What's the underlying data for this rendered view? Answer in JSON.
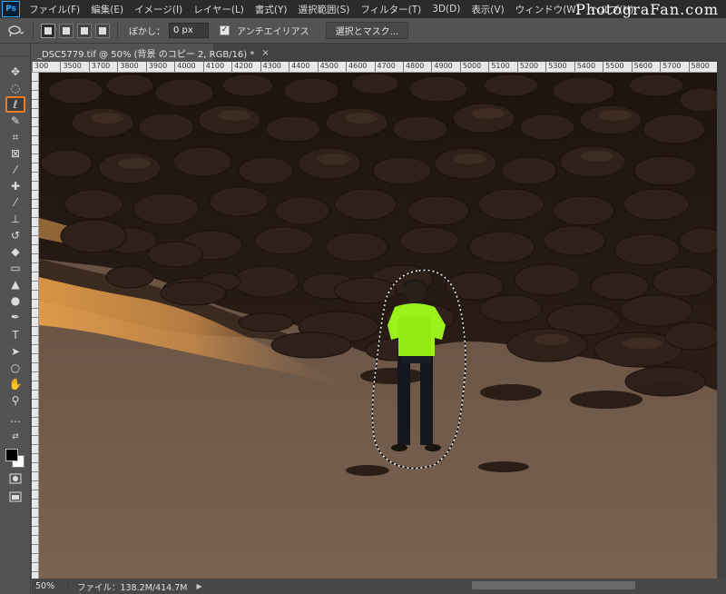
{
  "menu": {
    "logo": "Ps",
    "items": [
      "ファイル(F)",
      "編集(E)",
      "イメージ(I)",
      "レイヤー(L)",
      "書式(Y)",
      "選択範囲(S)",
      "フィルター(T)",
      "3D(D)",
      "表示(V)",
      "ウィンドウ(W)",
      "ヘルプ(H)"
    ],
    "watermark": "PhotograFan.com"
  },
  "options": {
    "feather_label": "ぼかし：",
    "feather_value": "0 px",
    "antialias_label": "アンチエイリアス",
    "antialias_checked": true,
    "select_mask_label": "選択とマスク..."
  },
  "document": {
    "tab_title": "_DSC5779.tif @ 50% (背景 のコピー 2, RGB/16) *",
    "close_glyph": "×"
  },
  "ruler": {
    "top_ticks": [
      "300",
      "3500",
      "3700",
      "3800",
      "3900",
      "4000",
      "4100",
      "4200",
      "4300",
      "4400",
      "4500",
      "4600",
      "4700",
      "4800",
      "4900",
      "5000",
      "5100",
      "5200",
      "5300",
      "5400",
      "5500",
      "5600",
      "5700",
      "5800"
    ]
  },
  "status": {
    "zoom": "50%",
    "file_info": "ファイル：138.2M/414.7M",
    "arrow": "▶"
  },
  "tools": [
    {
      "name": "move-tool-icon",
      "glyph": "✥"
    },
    {
      "name": "marquee-tool-icon",
      "glyph": "◌"
    },
    {
      "name": "lasso-tool-icon",
      "glyph": "ℓ"
    },
    {
      "name": "quick-select-tool-icon",
      "glyph": "✎"
    },
    {
      "name": "crop-tool-icon",
      "glyph": "⌗"
    },
    {
      "name": "frame-tool-icon",
      "glyph": "⊠"
    },
    {
      "name": "eyedropper-tool-icon",
      "glyph": "⁄"
    },
    {
      "name": "healing-brush-tool-icon",
      "glyph": "✚"
    },
    {
      "name": "brush-tool-icon",
      "glyph": "⁄"
    },
    {
      "name": "clone-stamp-tool-icon",
      "glyph": "⊥"
    },
    {
      "name": "history-brush-tool-icon",
      "glyph": "↺"
    },
    {
      "name": "eraser-tool-icon",
      "glyph": "◆"
    },
    {
      "name": "gradient-tool-icon",
      "glyph": "▭"
    },
    {
      "name": "blur-tool-icon",
      "glyph": "▲"
    },
    {
      "name": "dodge-tool-icon",
      "glyph": "●"
    },
    {
      "name": "pen-tool-icon",
      "glyph": "✒"
    },
    {
      "name": "type-tool-icon",
      "glyph": "T"
    },
    {
      "name": "path-select-tool-icon",
      "glyph": "➤"
    },
    {
      "name": "shape-tool-icon",
      "glyph": "○"
    },
    {
      "name": "hand-tool-icon",
      "glyph": "✋"
    },
    {
      "name": "zoom-tool-icon",
      "glyph": "⚲"
    },
    {
      "name": "more-tools-icon",
      "glyph": "…"
    }
  ],
  "colors": {
    "active_tool_border": "#f07a1f",
    "shirt": "#9bf21b",
    "foreground": "#000000",
    "background": "#ffffff"
  }
}
